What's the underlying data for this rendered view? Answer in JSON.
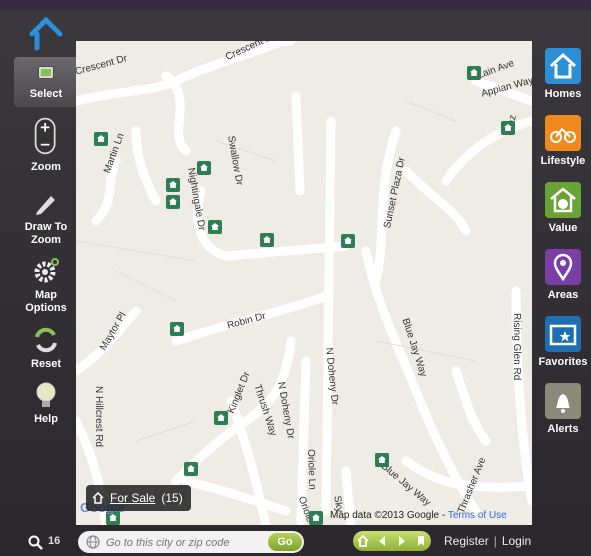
{
  "left_toolbar": [
    {
      "label": "Select",
      "icon": "select-icon"
    },
    {
      "label": "Zoom",
      "icon": "zoom-icon"
    },
    {
      "label": "Draw To\nZoom",
      "label_1": "Draw To",
      "label_2": "Zoom",
      "icon": "pencil-icon"
    },
    {
      "label": "Map\nOptions",
      "label_1": "Map",
      "label_2": "Options",
      "icon": "gear-icon"
    },
    {
      "label": "Reset",
      "icon": "reset-icon"
    },
    {
      "label": "Help",
      "icon": "lightbulb-icon"
    }
  ],
  "right_toolbar": [
    {
      "label": "Homes",
      "icon": "house-icon",
      "color": "#2a8fd6"
    },
    {
      "label": "Lifestyle",
      "icon": "bike-icon",
      "color": "#f08a1c"
    },
    {
      "label": "Value",
      "icon": "dollar-house-icon",
      "color": "#6aa335"
    },
    {
      "label": "Areas",
      "icon": "map-pin-icon",
      "color": "#7a3fa6"
    },
    {
      "label": "Favorites",
      "icon": "star-folder-icon",
      "color": "#1f6fb0"
    },
    {
      "label": "Alerts",
      "icon": "bell-icon",
      "color": "#8a8a7a"
    }
  ],
  "map": {
    "streets": {
      "crescent": "Crescent Dr",
      "crescent2": "Crescent Dr",
      "lainsave": "Lain Ave",
      "appian": "Appian Way",
      "martin": "Martin Ln",
      "swallow": "Swallow Dr",
      "nightingale": "Nightingale Dr",
      "sunset": "Sunset Plaza Dr",
      "robin": "Robin Dr",
      "maytor": "Maytor Pl",
      "bluejay": "Blue Jay Way",
      "bluejay2": "Blue Jay Way",
      "doheny": "N Doheny Dr",
      "doheny2": "N Doheny Dr",
      "kinglet": "Kinglet Dr",
      "thrush": "Thrush Way",
      "hillcrest": "N Hillcrest Rd",
      "oriole": "Oriole Ln",
      "oriole2": "Oriole",
      "thrasher": "Thrasher Ave",
      "risingglen": "Rising Glen Rd",
      "plaz": "Plaz",
      "skyw": "Sky"
    },
    "for_sale_label": "For Sale",
    "for_sale_count": "(15)",
    "attribution": "Map data ©2013 Google - ",
    "terms": "Terms of Use",
    "google_logo": "Google"
  },
  "bottom_bar": {
    "result_count": "16",
    "search_placeholder": "Go to this city or zip code",
    "go_label": "Go",
    "register": "Register",
    "separator": "|",
    "login": "Login"
  }
}
